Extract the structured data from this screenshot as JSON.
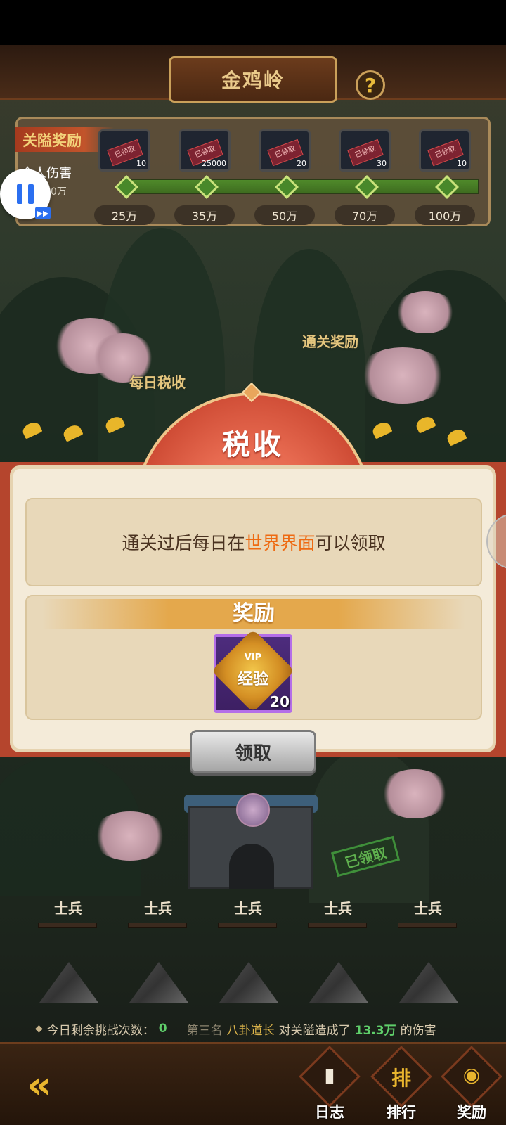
{
  "header": {
    "title": "金鸡岭",
    "help_symbol": "?"
  },
  "track": {
    "label": "关隘奖励",
    "personal_damage_label": "个人伤害",
    "personal_damage_value": "0万",
    "milestones": [
      {
        "value_label": "25万",
        "qty": "10",
        "ticket": "已领取"
      },
      {
        "value_label": "35万",
        "qty": "25000",
        "ticket": "已领取"
      },
      {
        "value_label": "50万",
        "qty": "20",
        "ticket": "已领取"
      },
      {
        "value_label": "70万",
        "qty": "30",
        "ticket": "已领取"
      },
      {
        "value_label": "100万",
        "qty": "10",
        "ticket": "已领取"
      }
    ]
  },
  "map": {
    "daily_tax_label": "每日税收",
    "clear_reward_label": "通关奖励",
    "claimed_stamp": "已领取"
  },
  "dialog": {
    "title": "税收",
    "message_prefix": "通关过后每日在",
    "message_highlight": "世界界面",
    "message_suffix": "可以领取",
    "reward_header": "奖励",
    "reward_item": {
      "badge": "VIP",
      "name": "经验",
      "qty": "20"
    },
    "claim_button": "领取"
  },
  "soldiers": [
    "士兵",
    "士兵",
    "士兵",
    "士兵",
    "士兵"
  ],
  "footer": {
    "attempts_label": "今日剩余挑战次数：",
    "attempts_value": "0",
    "rank_prefix": "第三名",
    "player_name": "八卦道长",
    "damage_text": "对关隘造成了",
    "damage_value": "13.3万",
    "damage_suffix": "的伤害"
  },
  "nav": {
    "log": "日志",
    "rank": "排行",
    "rank_glyph": "排",
    "reward": "奖励"
  },
  "colors": {
    "highlight": "#ee6a12",
    "accent_gold": "#e4a84c",
    "dialog_red": "#b5452d",
    "purple_frame": "#b46ee8"
  }
}
